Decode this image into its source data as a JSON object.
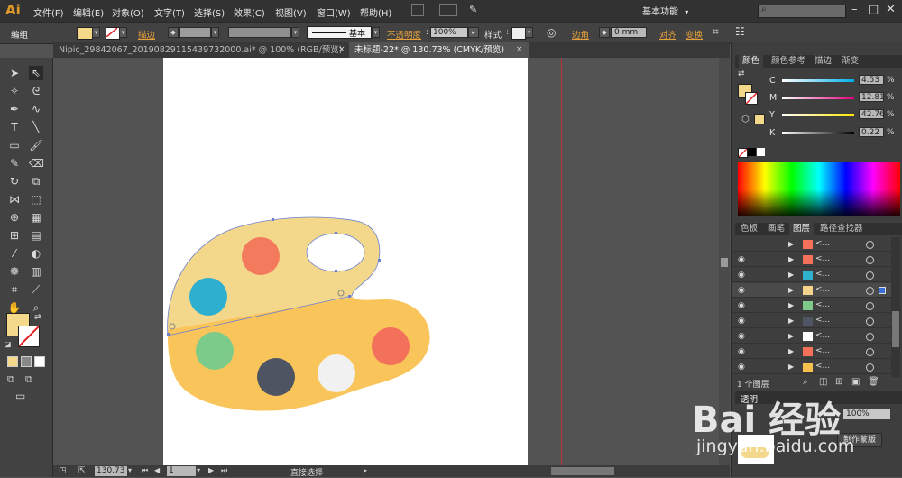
{
  "app": {
    "logo": "Ai"
  },
  "menu": [
    "文件(F)",
    "编辑(E)",
    "对象(O)",
    "文字(T)",
    "选择(S)",
    "效果(C)",
    "视图(V)",
    "窗口(W)",
    "帮助(H)"
  ],
  "workspace": {
    "label": "基本功能"
  },
  "control_bar": {
    "group_label": "编组",
    "stroke_label": "描边",
    "stroke_style_label": "基本",
    "opacity_label": "不透明度",
    "opacity_value": "100%",
    "style_label": "样式",
    "corner_label": "边角",
    "corner_value": "0 mm",
    "align_label": "对齐",
    "transform_label": "变换"
  },
  "tabs": [
    {
      "label": "Nipic_29842067_20190829115439732000.ai* @ 100% (RGB/预览)",
      "active": false
    },
    {
      "label": "未标题-22* @ 130.73% (CMYK/预览)",
      "active": true
    }
  ],
  "color_panel": {
    "tabs": [
      "颜色",
      "颜色参考",
      "描边",
      "渐变"
    ],
    "channels": [
      {
        "name": "C",
        "value": "4.53"
      },
      {
        "name": "M",
        "value": "12.81"
      },
      {
        "name": "Y",
        "value": "42.76"
      },
      {
        "name": "K",
        "value": "0.22"
      }
    ],
    "fill_color": "#F5D98A"
  },
  "layers_panel": {
    "tabs": [
      "色板",
      "画笔",
      "图层",
      "路径查找器"
    ],
    "rows": [
      {
        "thumb_color": "#F5705A",
        "label": "<..."
      },
      {
        "thumb_color": "#F5705A",
        "label": "<..."
      },
      {
        "thumb_color": "#2FB1CE",
        "label": "<..."
      },
      {
        "thumb_color": "#F3D38A",
        "label": "<..."
      },
      {
        "thumb_color": "#7DC98A",
        "label": "<..."
      },
      {
        "thumb_color": "#4F5562",
        "label": "<..."
      },
      {
        "thumb_color": "#FFFFFF",
        "label": "<..."
      },
      {
        "thumb_color": "#F5705A",
        "label": "<..."
      },
      {
        "thumb_color": "#F6C14E",
        "label": "<..."
      }
    ],
    "footer_label": "1 个图层"
  },
  "transparency_panel": {
    "title": "透明",
    "opacity": "100%",
    "make_mask_label": "制作蒙版"
  },
  "status_bar": {
    "zoom": "130.73",
    "page": "1",
    "tool_label": "直接选择"
  },
  "watermark": {
    "brand": "Bai 经验",
    "url": "jingyan.baidu.com"
  },
  "palette_colors": {
    "top_half": "#F3D78B",
    "bottom_half": "#F9C55A",
    "red": "#F47A5E",
    "blue": "#2EAFCF",
    "green": "#7CCB8A",
    "dark": "#4E5461",
    "white": "#F1F1F1",
    "red2": "#F3705A"
  }
}
